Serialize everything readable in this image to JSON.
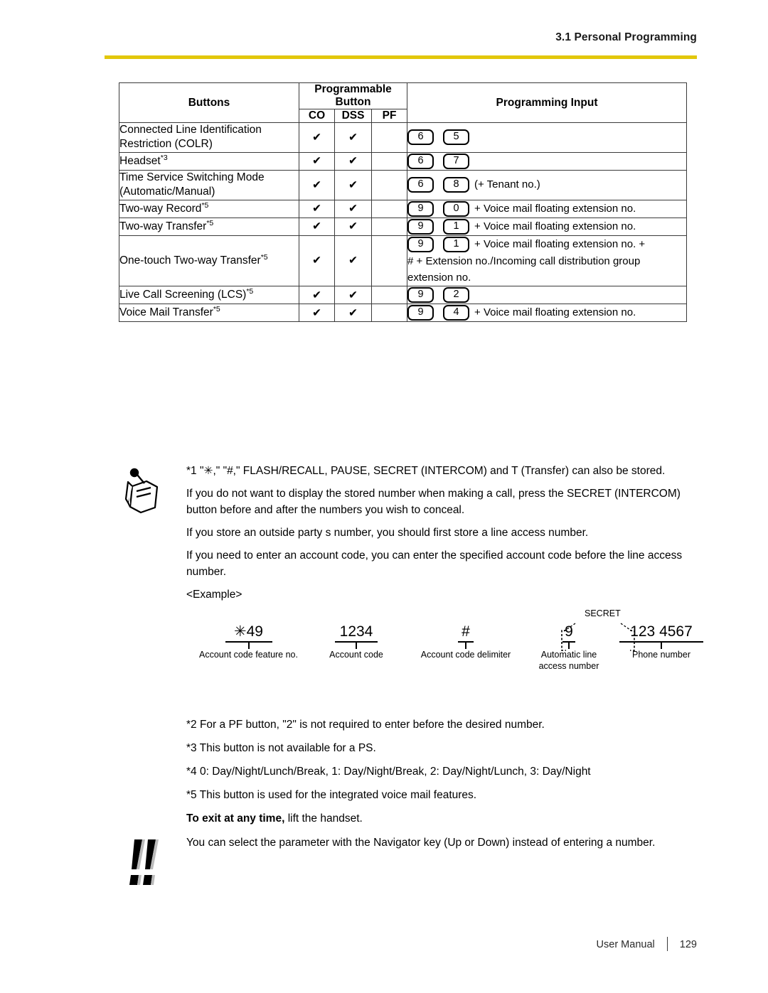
{
  "header": {
    "section_title": "3.1 Personal Programming",
    "rule_color": "#e2c70b"
  },
  "table": {
    "headers": {
      "buttons": "Buttons",
      "programmable_button": "Programmable Button",
      "programming_input": "Programming Input",
      "co": "CO",
      "dss": "DSS",
      "pf": "PF"
    },
    "check_glyph": "✔",
    "rows": [
      {
        "label": "Connected Line Identification Restriction (COLR)",
        "sup": "",
        "co": true,
        "dss": true,
        "pf": false,
        "keys": [
          "6",
          "5"
        ],
        "suffix": ""
      },
      {
        "label": "Headset",
        "sup": "*3",
        "co": true,
        "dss": true,
        "pf": false,
        "keys": [
          "6",
          "7"
        ],
        "suffix": ""
      },
      {
        "label": "Time Service Switching Mode (Automatic/Manual)",
        "sup": "",
        "co": true,
        "dss": true,
        "pf": false,
        "keys": [
          "6",
          "8"
        ],
        "suffix": "(+ Tenant no.)"
      },
      {
        "label": "Two-way Record",
        "sup": "*5",
        "co": true,
        "dss": true,
        "pf": false,
        "keys": [
          "9",
          "0"
        ],
        "suffix": "+ Voice mail floating extension no."
      },
      {
        "label": "Two-way Transfer",
        "sup": "*5",
        "co": true,
        "dss": true,
        "pf": false,
        "keys": [
          "9",
          "1"
        ],
        "suffix": "+ Voice mail floating extension no."
      },
      {
        "label": "One-touch Two-way Transfer",
        "sup": "*5",
        "co": true,
        "dss": true,
        "pf": false,
        "keys": [
          "9",
          "1"
        ],
        "suffix": "+ Voice mail floating extension no. +",
        "extra_lines": [
          "# + Extension no./Incoming call distribution group",
          "extension no."
        ]
      },
      {
        "label": "Live Call Screening (LCS)",
        "sup": "*5",
        "co": true,
        "dss": true,
        "pf": false,
        "keys": [
          "9",
          "2"
        ],
        "suffix": ""
      },
      {
        "label": "Voice Mail Transfer",
        "sup": "*5",
        "co": true,
        "dss": true,
        "pf": false,
        "keys": [
          "9",
          "4"
        ],
        "suffix": "+ Voice mail floating extension no."
      }
    ]
  },
  "note": {
    "icon": "note-pencil-icon",
    "paragraphs": [
      "*1 \"✳,\" \"#,\" FLASH/RECALL, PAUSE, SECRET (INTERCOM) and T (Transfer) can also be stored.",
      "If you do not want to display the stored number when making a call, press the SECRET (INTERCOM) button before and after the numbers you wish to conceal.",
      "If you store an outside party s number, you should first store a line access number.",
      "If you need to enter an account code, you can enter the specified account code before the line access number.",
      "<Example>"
    ]
  },
  "example": {
    "secret_label": "SECRET",
    "items": [
      {
        "value": "✳49",
        "caption": "Account code feature no."
      },
      {
        "value": "1234",
        "caption": "Account code"
      },
      {
        "value": "#",
        "caption": "Account code delimiter"
      },
      {
        "value": "9",
        "caption": "Automatic line access number"
      },
      {
        "value": "123  4567",
        "caption": "Phone number"
      }
    ]
  },
  "footnotes": {
    "items": [
      "*2 For a PF button, \"2\" is not required to enter before the desired number.",
      "*3 This button is not available for a PS.",
      "*4 0: Day/Night/Lunch/Break, 1: Day/Night/Break, 2: Day/Night/Lunch, 3: Day/Night",
      "*5 This button is used for the integrated voice mail features."
    ],
    "exit_bold": "To exit at any time,",
    "exit_rest": " lift the handset."
  },
  "hint": {
    "icon": "double-exclamation-icon",
    "text": "You can select the parameter with the Navigator key (Up or Down) instead of entering a number."
  },
  "footer": {
    "manual_label": "User Manual",
    "page_number": "129"
  }
}
